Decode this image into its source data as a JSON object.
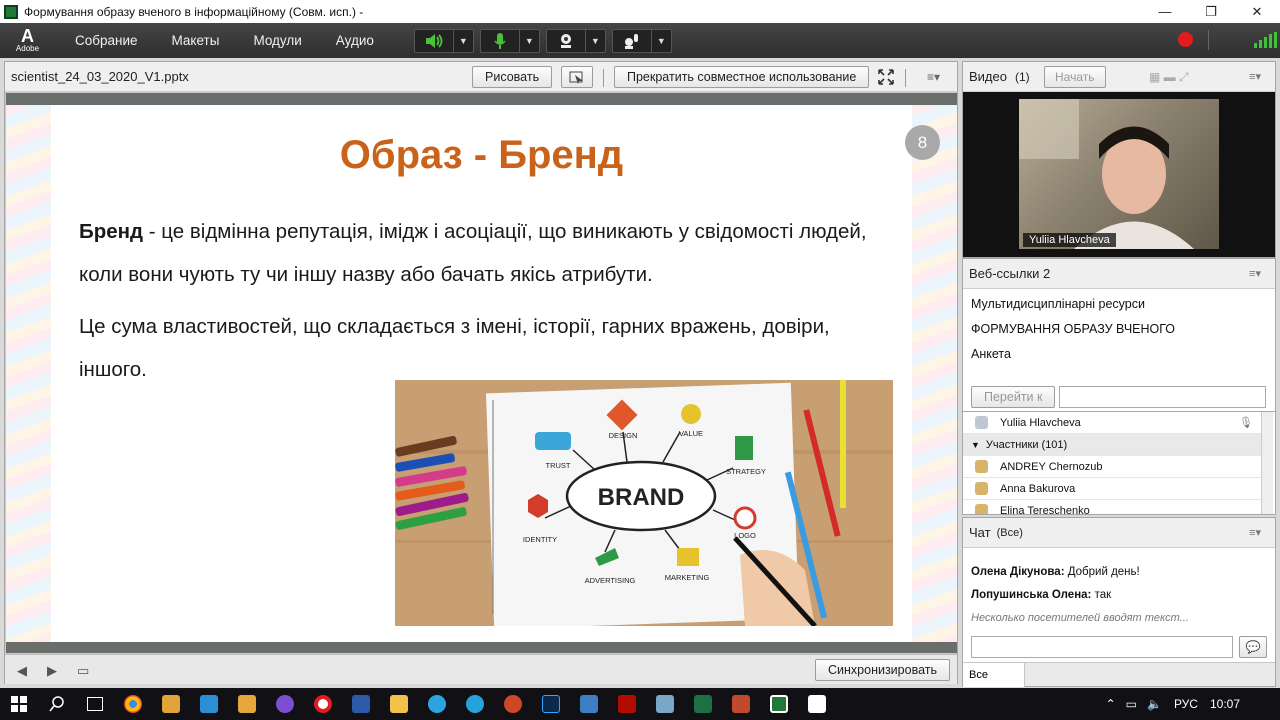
{
  "window": {
    "title": "Формування образу вченого в інформаційному (Совм. исп.) -",
    "controls": [
      "—",
      "❐",
      "✕"
    ]
  },
  "menubar": {
    "logo_text": "Adobe",
    "items": [
      "Собрание",
      "Макеты",
      "Модули",
      "Аудио"
    ]
  },
  "share": {
    "filename": "scientist_24_03_2020_V1.pptx",
    "draw_label": "Рисовать",
    "stop_label": "Прекратить совместное использование",
    "sync_label": "Синхронизировать"
  },
  "slide": {
    "number": "8",
    "title": "Образ - Бренд",
    "para1_bold": "Бренд",
    "para1_text": " - це відмінна репутація, імідж і асоціації, що виникають у свідомості людей, коли вони чують ту чи іншу назву або бачать якісь атрибути.",
    "para2_text": "Це сума властивостей, що складається з імені, історії, гарних вражень, довіри, іншого.",
    "image_labels": {
      "center": "BRAND",
      "design": "DESIGN",
      "value": "VALUE",
      "trust": "TRUST",
      "strategy": "STRATEGY",
      "identity": "IDENTITY",
      "logo": "LOGO",
      "advertising": "ADVERTISING",
      "marketing": "MARKETING"
    }
  },
  "video": {
    "title": "Видео",
    "count": "(1)",
    "start_label": "Начать",
    "presenter_name": "Yuliia Hlavcheva"
  },
  "links": {
    "title": "Веб-ссылки 2",
    "items": [
      "Мультидисциплінарні ресурси",
      "ФОРМУВАННЯ ОБРАЗУ ВЧЕНОГО",
      "Анкета"
    ],
    "goto_label": "Перейти к"
  },
  "attendees": {
    "host": "Yuliia Hlavcheva",
    "group_label": "Участники (101)",
    "rows": [
      "ANDREY Chernozub",
      "Anna Bakurova",
      "Elina Tereschenko"
    ]
  },
  "chat": {
    "title": "Чат",
    "scope": "(Все)",
    "messages": [
      {
        "author": "Олена Дікунова:",
        "text": " Добрий день!"
      },
      {
        "author": "Лопушинська Олена:",
        "text": " так"
      }
    ],
    "typing": "Несколько посетителей вводят текст...",
    "tab_all": "Все"
  },
  "taskbar": {
    "lang": "РУС",
    "time": "10:07"
  }
}
